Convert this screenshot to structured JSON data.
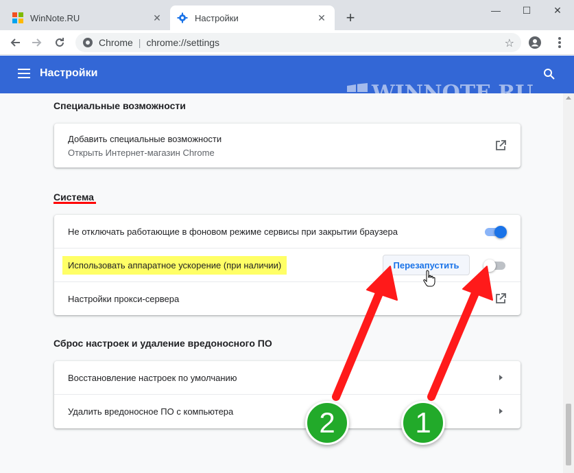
{
  "browser": {
    "tabs": [
      {
        "title": "WinNote.RU",
        "active": false
      },
      {
        "title": "Настройки",
        "active": true
      }
    ],
    "new_tab_label": "+",
    "window_controls": {
      "minimize": "—",
      "maximize": "☐",
      "close": "✕"
    },
    "omnibox": {
      "host": "Chrome",
      "separator": "|",
      "url": "chrome://settings"
    }
  },
  "header": {
    "title": "Настройки",
    "watermark": "WINNOTE.RU"
  },
  "sections": {
    "accessibility": {
      "title": "Специальные возможности",
      "items": [
        {
          "label": "Добавить специальные возможности",
          "sublabel": "Открыть Интернет-магазин Chrome"
        }
      ]
    },
    "system": {
      "title": "Система",
      "items": [
        {
          "label": "Не отключать работающие в фоновом режиме сервисы при закрытии браузера",
          "toggle": "on"
        },
        {
          "label": "Использовать аппаратное ускорение (при наличии)",
          "button": "Перезапустить",
          "toggle": "off"
        },
        {
          "label": "Настройки прокси-сервера"
        }
      ]
    },
    "reset": {
      "title": "Сброс настроек и удаление вредоносного ПО",
      "items": [
        {
          "label": "Восстановление настроек по умолчанию"
        },
        {
          "label": "Удалить вредоносное ПО с компьютера"
        }
      ]
    }
  },
  "annotations": {
    "badge_1": "1",
    "badge_2": "2"
  },
  "colors": {
    "header": "#3367d6",
    "accent": "#1a73e8",
    "highlight": "#ffff66",
    "arrow": "#ff1a1a",
    "badge": "#22aa2a"
  }
}
